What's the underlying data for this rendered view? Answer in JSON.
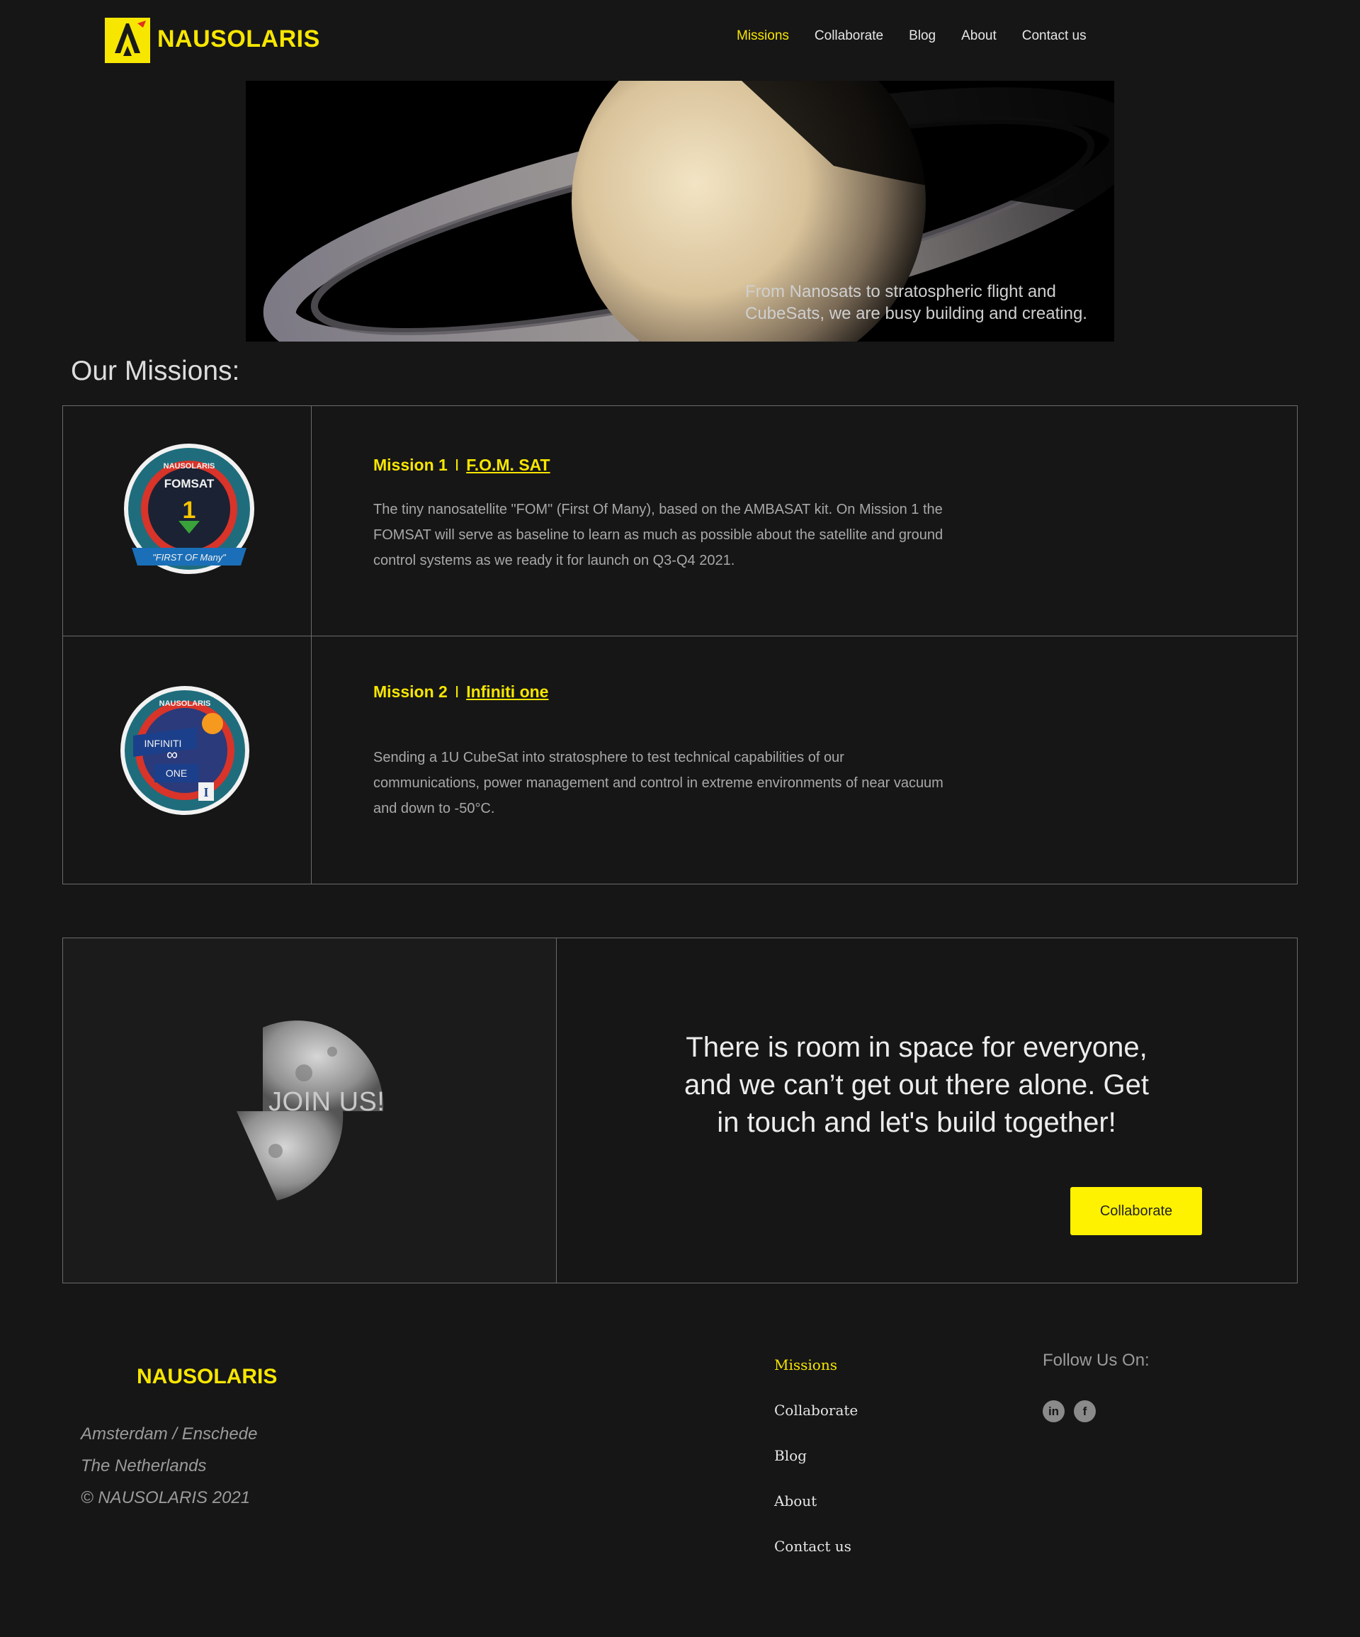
{
  "header": {
    "logo_text": "NAUSOLARIS",
    "nav": [
      {
        "label": "Missions",
        "active": true
      },
      {
        "label": "Collaborate"
      },
      {
        "label": "Blog"
      },
      {
        "label": "About"
      },
      {
        "label": "Contact us"
      }
    ]
  },
  "hero": {
    "caption": "From Nanosats to stratospheric flight and CubeSats, we are busy building and creating."
  },
  "missions": {
    "title": "Our Missions:",
    "items": [
      {
        "label": "Mission 1",
        "separator": "I",
        "name": "F.O.M. SAT",
        "description": "The tiny nanosatellite \"FOM\" (First Of Many), based on the AMBASAT kit. On Mission 1 the FOMSAT will serve as baseline to learn as much as possible about the satellite and ground control systems as we ready it for launch on Q3-Q4 2021.",
        "badge": {
          "top_text": "NAUSOLARIS",
          "center_text": "FOMSAT",
          "number": "1",
          "ribbon_text": "\"FIRST OF Many\"",
          "icon": "fomsat-badge-icon"
        }
      },
      {
        "label": "Mission 2",
        "separator": "I",
        "name": "Infiniti one",
        "description": "Sending a 1U CubeSat into stratosphere to test technical capabilities of our communications, power management and control in extreme environments of near vacuum and down to -50°C.",
        "badge": {
          "top_text": "NAUSOLARIS",
          "line1": "INFINITI",
          "line2": "ONE",
          "mark": "I",
          "icon": "infiniti-one-badge-icon"
        }
      }
    ]
  },
  "join": {
    "label": "JOIN US!",
    "quote": "There is room in space for everyone, and we can’t get out there alone. Get in touch and let's build together!",
    "button_label": "Collaborate"
  },
  "footer": {
    "logo_text": "NAUSOLARIS",
    "address": [
      "Amsterdam / Enschede",
      "The Netherlands",
      "© NAUSOLARIS 2021"
    ],
    "nav": [
      {
        "label": "Missions",
        "active": true
      },
      {
        "label": "Collaborate"
      },
      {
        "label": "Blog"
      },
      {
        "label": "About"
      },
      {
        "label": "Contact us"
      }
    ],
    "follow_label": "Follow Us On:",
    "social": [
      {
        "icon": "linkedin-icon",
        "glyph": "in"
      },
      {
        "icon": "facebook-icon",
        "glyph": "f"
      }
    ]
  },
  "colors": {
    "accent": "#f7e600",
    "background": "#161616",
    "border": "#6b6b6b"
  }
}
